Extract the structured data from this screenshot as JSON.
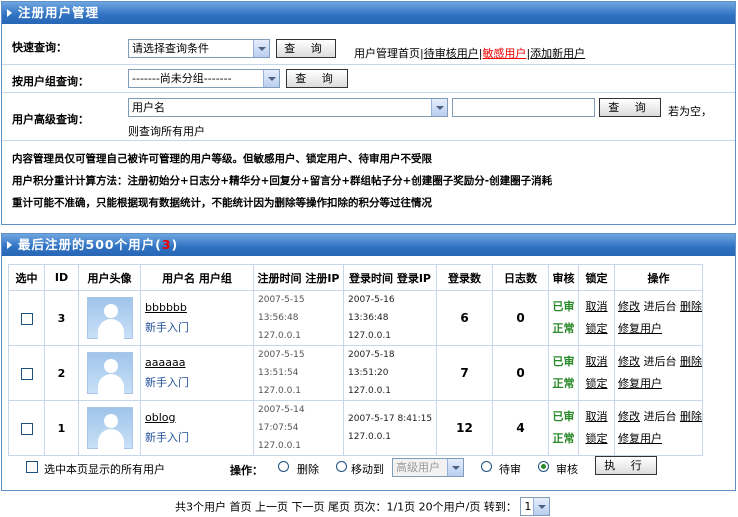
{
  "top_panel": {
    "title": "注册用户管理"
  },
  "quick": {
    "label": "快速查询：",
    "select_value": "请选择查询条件",
    "button": "查 询",
    "links": [
      "用户管理首页",
      "待审核用户",
      "敏感用户",
      "添加新用户"
    ],
    "sep": "|"
  },
  "group": {
    "label": "按用户组查询：",
    "select_value": "-------尚未分组-------",
    "button": "查 询"
  },
  "advanced": {
    "label": "用户高级查询：",
    "select_value": "用户名",
    "button": "查 询",
    "hint1": "若为空，",
    "hint2": "则查询所有用户"
  },
  "notes": [
    "内容管理员仅可管理自己被许可管理的用户等级。但敏感用户、锁定用户、待审用户不受限",
    "用户积分重计计算方法：注册初始分+日志分+精华分+回复分+留言分+群组帖子分+创建圈子奖励分-创建圈子消耗",
    "重计可能不准确，只能根据现有数据统计，不能统计因为删除等操作扣除的积分等过往情况"
  ],
  "list_panel": {
    "title_pre": "最后注册的500个用户(",
    "count": "3",
    "title_post": ")"
  },
  "columns": {
    "select": "选中",
    "id": "ID",
    "avatar": "用户头像",
    "name_group": "用户名 用户组",
    "reg_time": "注册时间",
    "reg_ip": "注册IP",
    "login_time": "登录时间",
    "login_ip": "登录IP",
    "logins": "登录数",
    "logs": "日志数",
    "audit": "审核",
    "lock": "锁定",
    "ops": "操作"
  },
  "users": [
    {
      "id": "3",
      "name": "bbbbbb",
      "group": "新手入门",
      "reg_time": "2007-5-15 13:56:48",
      "reg_ip": "127.0.0.1",
      "login_time": "2007-5-16 13:36:48",
      "login_ip": "127.0.0.1",
      "logins": "6",
      "logs": "0",
      "audit": "已审",
      "audit_act": "取消",
      "status": "正常",
      "lock_act": "锁定",
      "op1": "修改",
      "op2": "进后台",
      "op3": "删除",
      "op4": "修复用户"
    },
    {
      "id": "2",
      "name": "aaaaaa",
      "group": "新手入门",
      "reg_time": "2007-5-15 13:51:54",
      "reg_ip": "127.0.0.1",
      "login_time": "2007-5-18 13:51:20",
      "login_ip": "127.0.0.1",
      "logins": "7",
      "logs": "0",
      "audit": "已审",
      "audit_act": "取消",
      "status": "正常",
      "lock_act": "锁定",
      "op1": "修改",
      "op2": "进后台",
      "op3": "删除",
      "op4": "修复用户"
    },
    {
      "id": "1",
      "name": "oblog",
      "group": "新手入门",
      "reg_time": "2007-5-14 17:07:54",
      "reg_ip": "127.0.0.1",
      "login_time": "2007-5-17 8:41:15",
      "login_ip": "127.0.0.1",
      "logins": "12",
      "logs": "4",
      "audit": "已审",
      "audit_act": "取消",
      "status": "正常",
      "lock_act": "锁定",
      "op1": "修改",
      "op2": "进后台",
      "op3": "删除",
      "op4": "修复用户"
    }
  ],
  "footer_bar": {
    "select_all": "选中本页显示的所有用户",
    "action_label": "操作：",
    "delete": "删除",
    "move": "移动到",
    "move_target": "高级用户",
    "pending": "待审",
    "approve": "审核",
    "execute": "执 行"
  },
  "pager": {
    "text": "共3个用户  首页  上一页 下一页  尾页 页次：1/1页  20个用户/页 转到：",
    "page": "1"
  }
}
